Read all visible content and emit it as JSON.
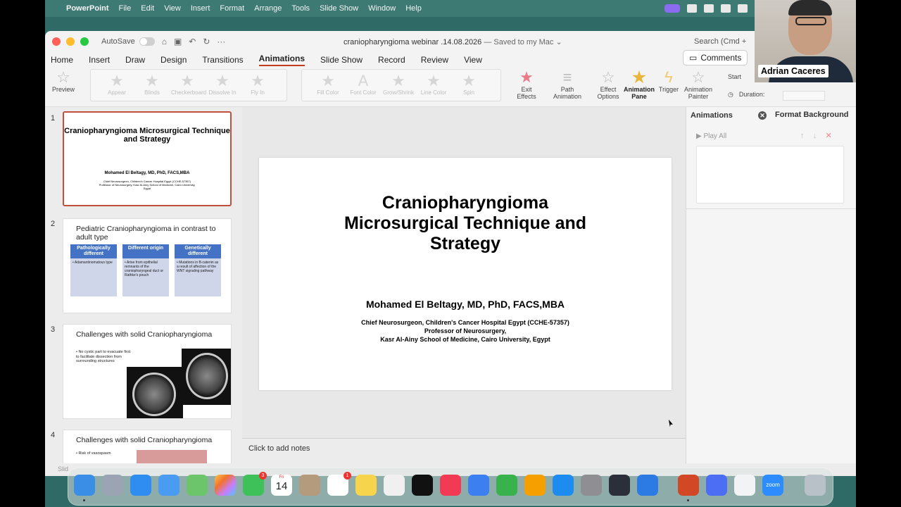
{
  "menubar": {
    "app_name": "PowerPoint",
    "items": [
      "File",
      "Edit",
      "View",
      "Insert",
      "Format",
      "Arrange",
      "Tools",
      "Slide Show",
      "Window",
      "Help"
    ]
  },
  "window": {
    "autosave_label": "AutoSave",
    "doc_title": "craniopharyngioma  webinar .14.08.2026",
    "saved_status": "— Saved to my Mac ⌄",
    "search_placeholder": "Search (Cmd +",
    "comments_label": "Comments"
  },
  "ribbon_tabs": [
    "Home",
    "Insert",
    "Draw",
    "Design",
    "Transitions",
    "Animations",
    "Slide Show",
    "Record",
    "Review",
    "View"
  ],
  "active_tab": "Animations",
  "ribbon": {
    "preview_label": "Preview",
    "entrance_gallery": [
      "Appear",
      "Blinds",
      "Checkerboard",
      "Dissolve In",
      "Fly In"
    ],
    "emphasis_gallery": [
      "Fill Color",
      "Font Color",
      "Grow/Shrink",
      "Line Color",
      "Spin"
    ],
    "exit_effects": "Exit Effects",
    "path_animation": "Path Animation",
    "effect_options": "Effect Options",
    "animation_pane": "Animation Pane",
    "trigger": "Trigger",
    "animation_painter": "Animation Painter",
    "start_label": "Start",
    "duration_label": "Duration:"
  },
  "thumbnails": [
    {
      "number": "1",
      "title": "Craniopharyngioma Microsurgical Technique and Strategy",
      "author": "Mohamed El Beltagy, MD, PhD, FACS,MBA",
      "affiliation": "Chief Neurosurgeon, Children's Cancer Hospital Egypt (CCHE-57357) Professor of Neurosurgery, Kasr Al-Ainy School of Medicine, Cairo University, Egypt"
    },
    {
      "number": "2",
      "title": "Pediatric Craniopharyngioma in contrast to adult type",
      "columns": [
        {
          "header": "Pathologically different",
          "body": "• Adamantinomatous type"
        },
        {
          "header": "Different origin",
          "body": "• Arise from epithelial remnants of the craniopharyngeal duct or Rathke's pouch"
        },
        {
          "header": "Genetically different",
          "body": "• Mutations in B-catenin as a result of affection of the WNT signaling pathway"
        }
      ]
    },
    {
      "number": "3",
      "title": "Challenges with solid Craniopharyngioma",
      "bullet": "• No cystic part to evacuate first to facilitate dissection from surrounding structures"
    },
    {
      "number": "4",
      "title": "Challenges with solid Craniopharyngioma",
      "bullet": "• Risk of vasospasm"
    }
  ],
  "main_slide": {
    "title": "Craniopharyngioma Microsurgical Technique and Strategy",
    "author": "Mohamed El Beltagy, MD, PhD, FACS,MBA",
    "affiliation_line1": "Chief Neurosurgeon, Children's Cancer Hospital Egypt (CCHE-57357)",
    "affiliation_line2": "Professor of Neurosurgery,",
    "affiliation_line3": "Kasr  Al-Ainy School of Medicine, Cairo University, Egypt"
  },
  "notes_placeholder": "Click to add notes",
  "animation_pane": {
    "tab_animations": "Animations",
    "tab_format_background": "Format Background",
    "play_all": "Play All"
  },
  "statusbar_text": "Slid",
  "dock": {
    "calendar_month": "Fri",
    "calendar_day": "14",
    "facetime_badge": "3",
    "reminders_badge": "1",
    "zoom_label": "zoom"
  },
  "webcam": {
    "participant_name": "Adrian Caceres"
  },
  "colors": {
    "accent_tab_underline": "#c43e1c",
    "slide_selection_border": "#c0503b",
    "table_header_blue": "#4472c4",
    "desktop_teal": "#2f6a66"
  }
}
